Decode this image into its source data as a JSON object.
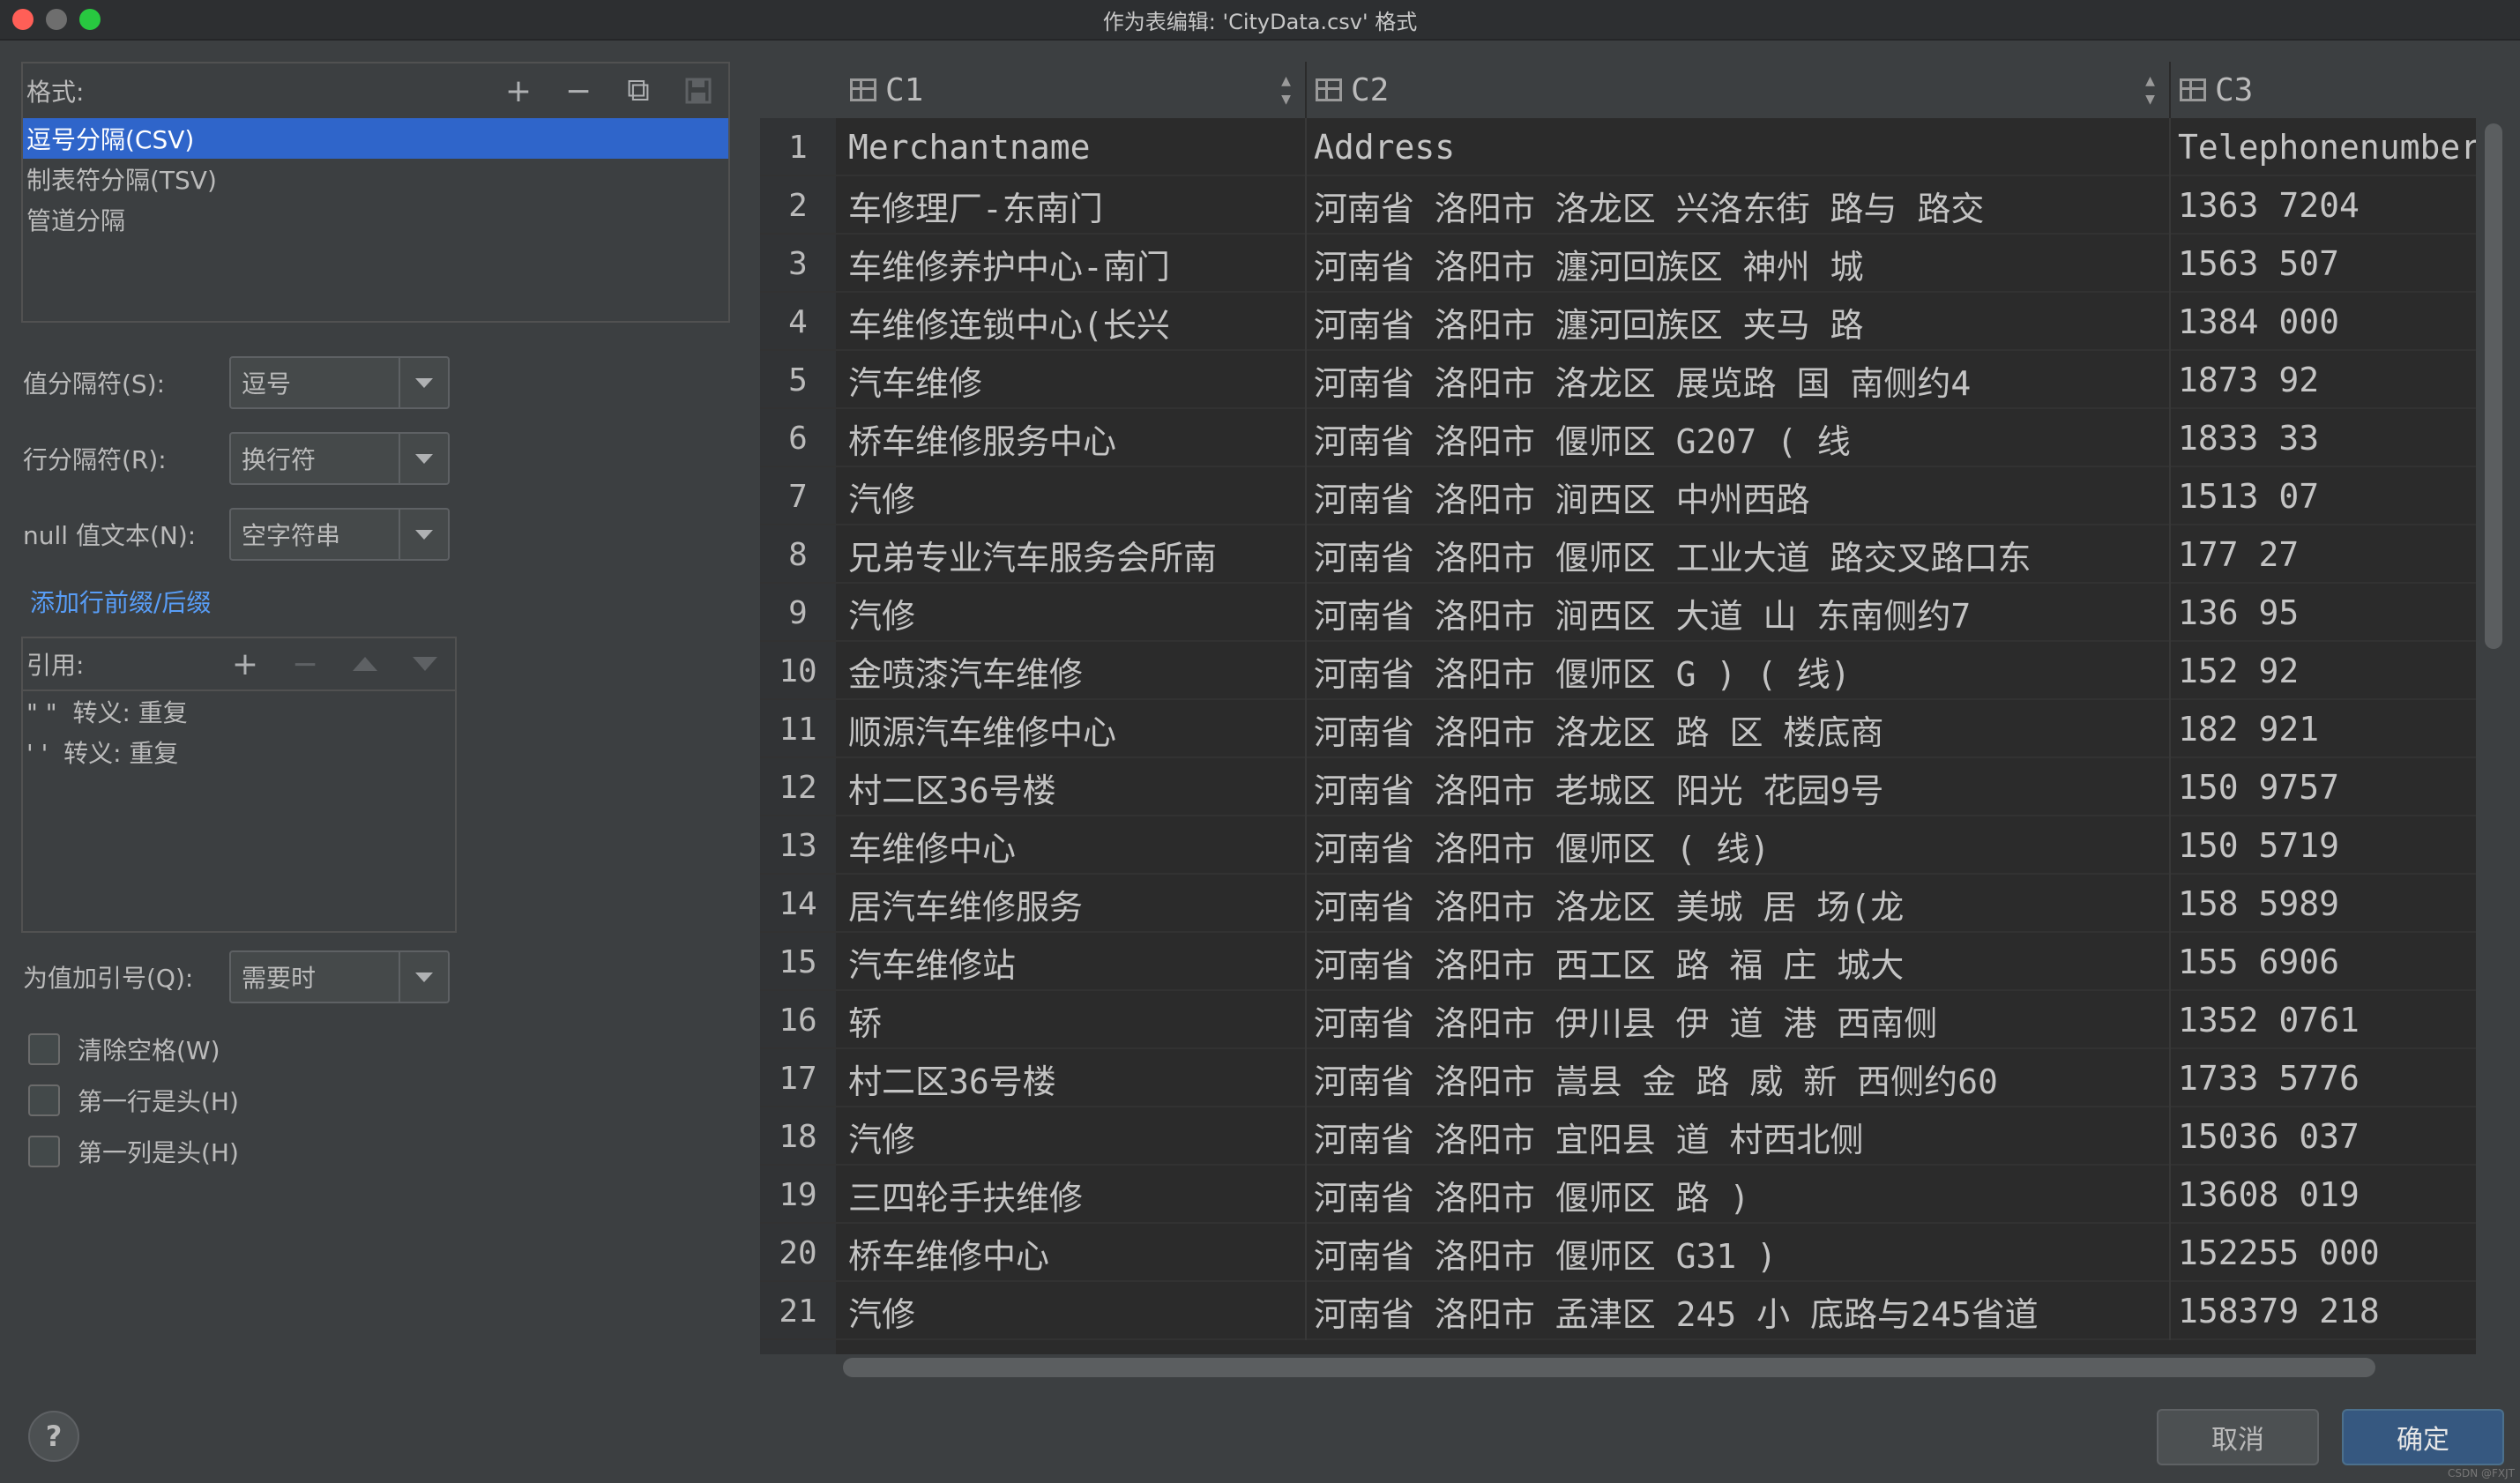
{
  "window": {
    "title": "作为表编辑: 'CityData.csv' 格式"
  },
  "formats": {
    "label": "格式:",
    "toolbar": {
      "add": "+",
      "remove": "−",
      "copy": "⧉",
      "save": "💾"
    },
    "items": [
      "逗号分隔(CSV)",
      "制表符分隔(TSV)",
      "管道分隔"
    ],
    "selected_index": 0
  },
  "settings": {
    "value_separator": {
      "label": "值分隔符(S):",
      "value": "逗号"
    },
    "row_separator": {
      "label": "行分隔符(R):",
      "value": "换行符"
    },
    "null_text": {
      "label": "null 值文本(N):",
      "value": "空字符串"
    },
    "add_prefix_link": "添加行前缀/后缀",
    "quote_values": {
      "label": "为值加引号(Q):",
      "value": "需要时"
    }
  },
  "quotes": {
    "label": "引用:",
    "toolbar": {
      "add": "+",
      "remove": "−"
    },
    "items": [
      "\" \"  转义: 重复",
      "' '  转义: 重复"
    ]
  },
  "checks": {
    "trim": {
      "label": "清除空格(W)",
      "checked": false
    },
    "first_row_header": {
      "label": "第一行是头(H)",
      "checked": false
    },
    "first_col_header": {
      "label": "第一列是头(H)",
      "checked": false
    }
  },
  "table": {
    "columns": [
      "C1",
      "C2",
      "C3"
    ],
    "rows": [
      [
        "1",
        "Merchantname",
        "Address",
        "Telephonenumber"
      ],
      [
        "2",
        "车修理厂-东南门",
        "河南省 洛阳市 洛龙区 兴洛东街 路与 路交",
        "1363 7204"
      ],
      [
        "3",
        "车维修养护中心-南门",
        "河南省 洛阳市 瀍河回族区 神州 城 ",
        "1563 507"
      ],
      [
        "4",
        "车维修连锁中心(长兴",
        "河南省 洛阳市 瀍河回族区 夹马 路",
        "1384 000"
      ],
      [
        "5",
        "汽车维修",
        "河南省 洛阳市 洛龙区 展览路 国 南侧约4",
        "1873 92"
      ],
      [
        "6",
        "桥车维修服务中心",
        "河南省 洛阳市 偃师区 G207 ( 线",
        "1833 33"
      ],
      [
        "7",
        "汽修",
        "河南省 洛阳市 涧西区 中州西路",
        "1513 07"
      ],
      [
        "8",
        "兄弟专业汽车服务会所南",
        "河南省 洛阳市 偃师区 工业大道 路交叉路口东",
        "177 27"
      ],
      [
        "9",
        "汽修",
        "河南省 洛阳市 涧西区 大道 山 东南侧约7",
        "136 95"
      ],
      [
        "10",
        "金喷漆汽车维修",
        "河南省 洛阳市 偃师区 G ) ( 线)",
        "152 92"
      ],
      [
        "11",
        "顺源汽车维修中心",
        "河南省 洛阳市 洛龙区 路 区 楼底商",
        "182 921"
      ],
      [
        "12",
        "村二区36号楼",
        "河南省 洛阳市 老城区 阳光 花园9号",
        "150 9757"
      ],
      [
        "13",
        "车维修中心",
        "河南省 洛阳市 偃师区 ( 线)",
        "150 5719"
      ],
      [
        "14",
        "居汽车维修服务",
        "河南省 洛阳市 洛龙区 美城 居 场(龙",
        "158 5989"
      ],
      [
        "15",
        "汽车维修站",
        "河南省 洛阳市 西工区 路 福 庄 城大",
        "155 6906"
      ],
      [
        "16",
        "轿",
        "河南省 洛阳市 伊川县 伊 道 港 西南侧",
        "1352 0761"
      ],
      [
        "17",
        "村二区36号楼",
        "河南省 洛阳市 嵩县 金 路 威 新 西侧约60",
        "1733 5776"
      ],
      [
        "18",
        "汽修",
        "河南省 洛阳市 宜阳县 道 村西北侧",
        "15036 037"
      ],
      [
        "19",
        "三四轮手扶维修",
        "河南省 洛阳市 偃师区 路 )",
        "13608 019"
      ],
      [
        "20",
        "桥车维修中心",
        "河南省 洛阳市 偃师区 G31 )",
        "152255 000"
      ],
      [
        "21",
        "汽修",
        "河南省 洛阳市 孟津区 245 小 底路与245省道",
        "158379 218"
      ]
    ]
  },
  "footer": {
    "help": "?",
    "cancel": "取消",
    "ok": "确定",
    "watermark": "CSDN @FXJT"
  }
}
